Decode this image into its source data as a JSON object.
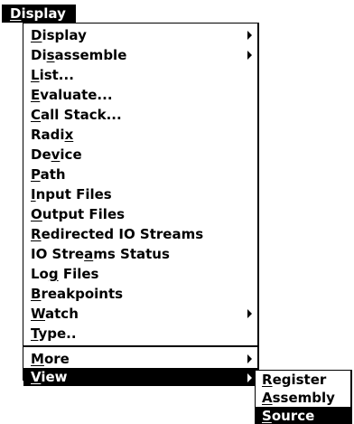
{
  "menubar": {
    "title_prefix": "",
    "title_mnemonic": "D",
    "title_suffix": "isplay"
  },
  "menu": {
    "items": [
      {
        "pre": "",
        "mn": "D",
        "post": "isplay",
        "submenu": true
      },
      {
        "pre": "Di",
        "mn": "s",
        "post": "assemble",
        "submenu": true
      },
      {
        "pre": "",
        "mn": "L",
        "post": "ist...",
        "submenu": false
      },
      {
        "pre": "",
        "mn": "E",
        "post": "valuate...",
        "submenu": false
      },
      {
        "pre": "",
        "mn": "C",
        "post": "all Stack...",
        "submenu": false
      },
      {
        "pre": "Radi",
        "mn": "x",
        "post": "",
        "submenu": false
      },
      {
        "pre": "De",
        "mn": "v",
        "post": "ice",
        "submenu": false
      },
      {
        "pre": "",
        "mn": "P",
        "post": "ath",
        "submenu": false
      },
      {
        "pre": "",
        "mn": "I",
        "post": "nput Files",
        "submenu": false
      },
      {
        "pre": "",
        "mn": "O",
        "post": "utput Files",
        "submenu": false
      },
      {
        "pre": "",
        "mn": "R",
        "post": "edirected IO Streams",
        "submenu": false
      },
      {
        "pre": "IO Stre",
        "mn": "a",
        "post": "ms Status",
        "submenu": false
      },
      {
        "pre": "Lo",
        "mn": "g",
        "post": " Files",
        "submenu": false
      },
      {
        "pre": "",
        "mn": "B",
        "post": "reakpoints",
        "submenu": false
      },
      {
        "pre": "",
        "mn": "W",
        "post": "atch",
        "submenu": true
      },
      {
        "pre": "",
        "mn": "T",
        "post": "ype..",
        "submenu": false
      },
      {
        "pre": "",
        "mn": "M",
        "post": "ore",
        "submenu": true
      },
      {
        "pre": "",
        "mn": "V",
        "post": "iew",
        "submenu": true
      }
    ]
  },
  "view_submenu": {
    "items": [
      {
        "pre": "",
        "mn": "R",
        "post": "egister"
      },
      {
        "pre": "",
        "mn": "A",
        "post": "ssembly"
      },
      {
        "pre": "",
        "mn": "S",
        "post": "ource"
      }
    ]
  },
  "colors": {
    "highlight_bg": "#000000",
    "highlight_fg": "#ffffff",
    "menu_bg": "#ffffff"
  }
}
